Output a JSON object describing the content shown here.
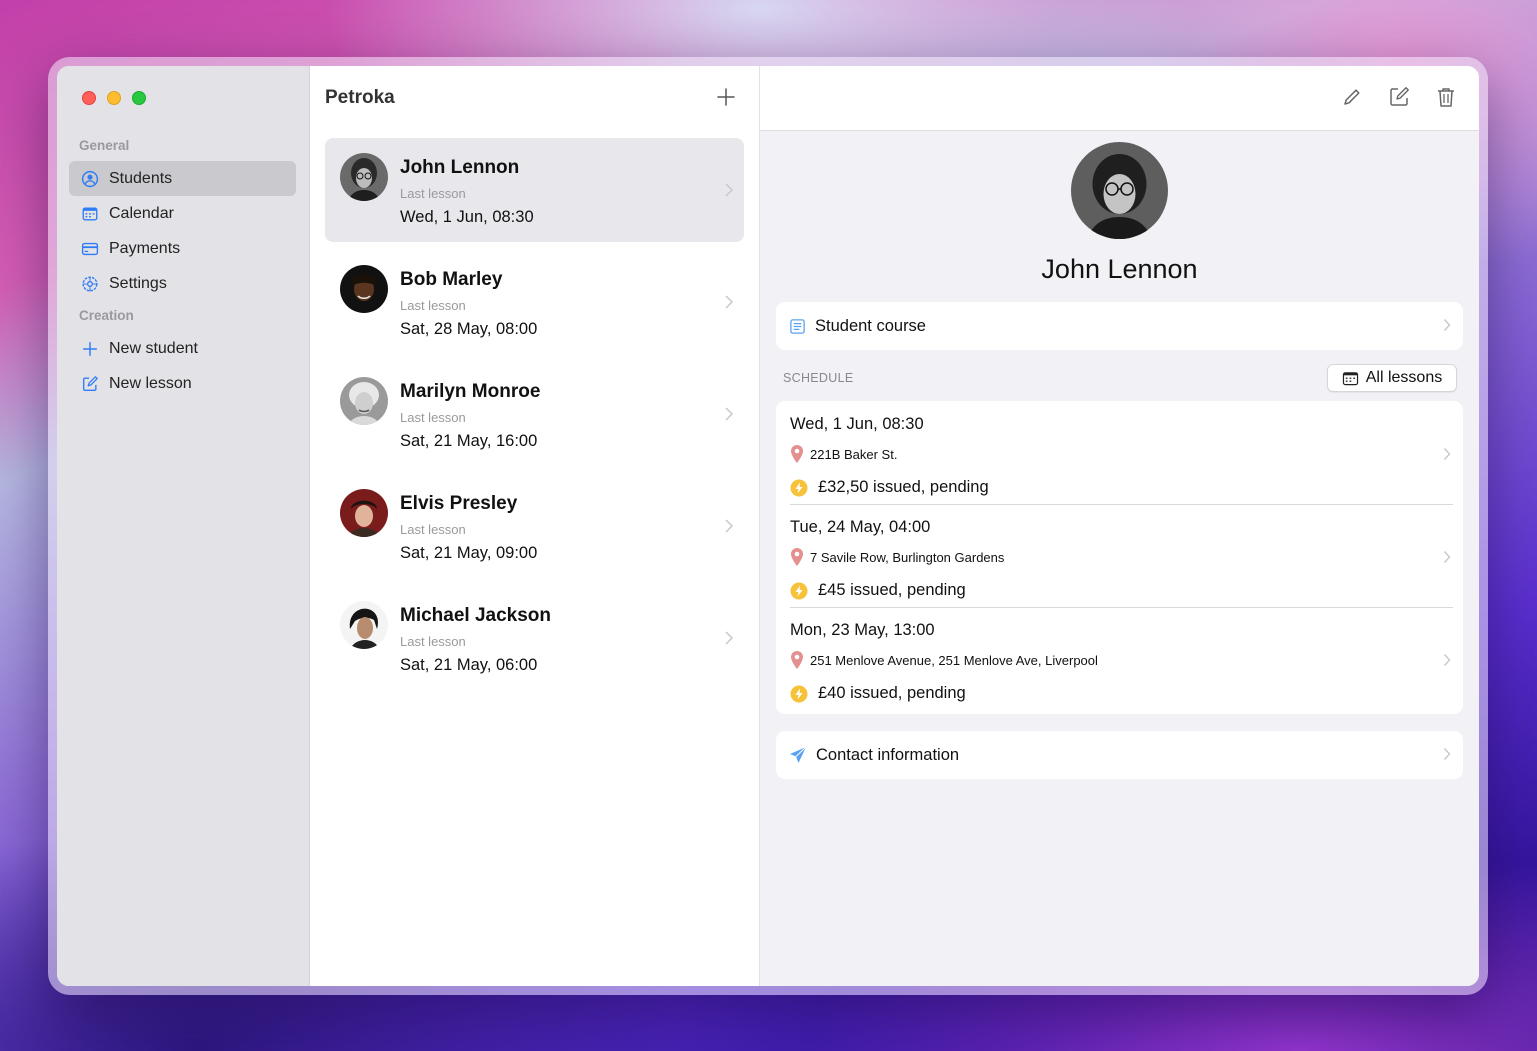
{
  "app": {
    "list_title": "Petroka"
  },
  "sidebar": {
    "sections": [
      {
        "label": "General"
      },
      {
        "label": "Creation"
      }
    ],
    "items": [
      {
        "label": "Students",
        "icon": "person-circle-icon",
        "active": true
      },
      {
        "label": "Calendar",
        "icon": "calendar-icon"
      },
      {
        "label": "Payments",
        "icon": "credit-card-icon"
      },
      {
        "label": "Settings",
        "icon": "gear-icon"
      },
      {
        "label": "New student",
        "icon": "plus-icon"
      },
      {
        "label": "New lesson",
        "icon": "square-pencil-icon"
      }
    ]
  },
  "students": [
    {
      "name": "John Lennon",
      "sub": "Last lesson",
      "date": "Wed, 1 Jun, 08:30",
      "selected": true
    },
    {
      "name": "Bob Marley",
      "sub": "Last lesson",
      "date": "Sat, 28 May, 08:00"
    },
    {
      "name": "Marilyn Monroe",
      "sub": "Last lesson",
      "date": "Sat, 21 May, 16:00"
    },
    {
      "name": "Elvis Presley",
      "sub": "Last lesson",
      "date": "Sat, 21 May, 09:00"
    },
    {
      "name": "Michael Jackson",
      "sub": "Last lesson",
      "date": "Sat, 21 May, 06:00"
    }
  ],
  "detail": {
    "name": "John Lennon",
    "course_label": "Student course",
    "schedule_label": "SCHEDULE",
    "all_lessons_label": "All lessons",
    "lessons": [
      {
        "date": "Wed, 1 Jun, 08:30",
        "address": "221B Baker St.",
        "payment": "£32,50 issued, pending"
      },
      {
        "date": "Tue, 24 May, 04:00",
        "address": "7 Savile Row, Burlington Gardens",
        "payment": "£45 issued, pending"
      },
      {
        "date": "Mon, 23 May, 13:00",
        "address": "251 Menlove Avenue, 251 Menlove Ave, Liverpool",
        "payment": "£40 issued, pending"
      }
    ],
    "contact_label": "Contact information"
  },
  "colors": {
    "accent": "#2f7cf6",
    "selection": "#e8e8ec",
    "pin": "#e07a7a",
    "bolt": "#f6c23a"
  }
}
